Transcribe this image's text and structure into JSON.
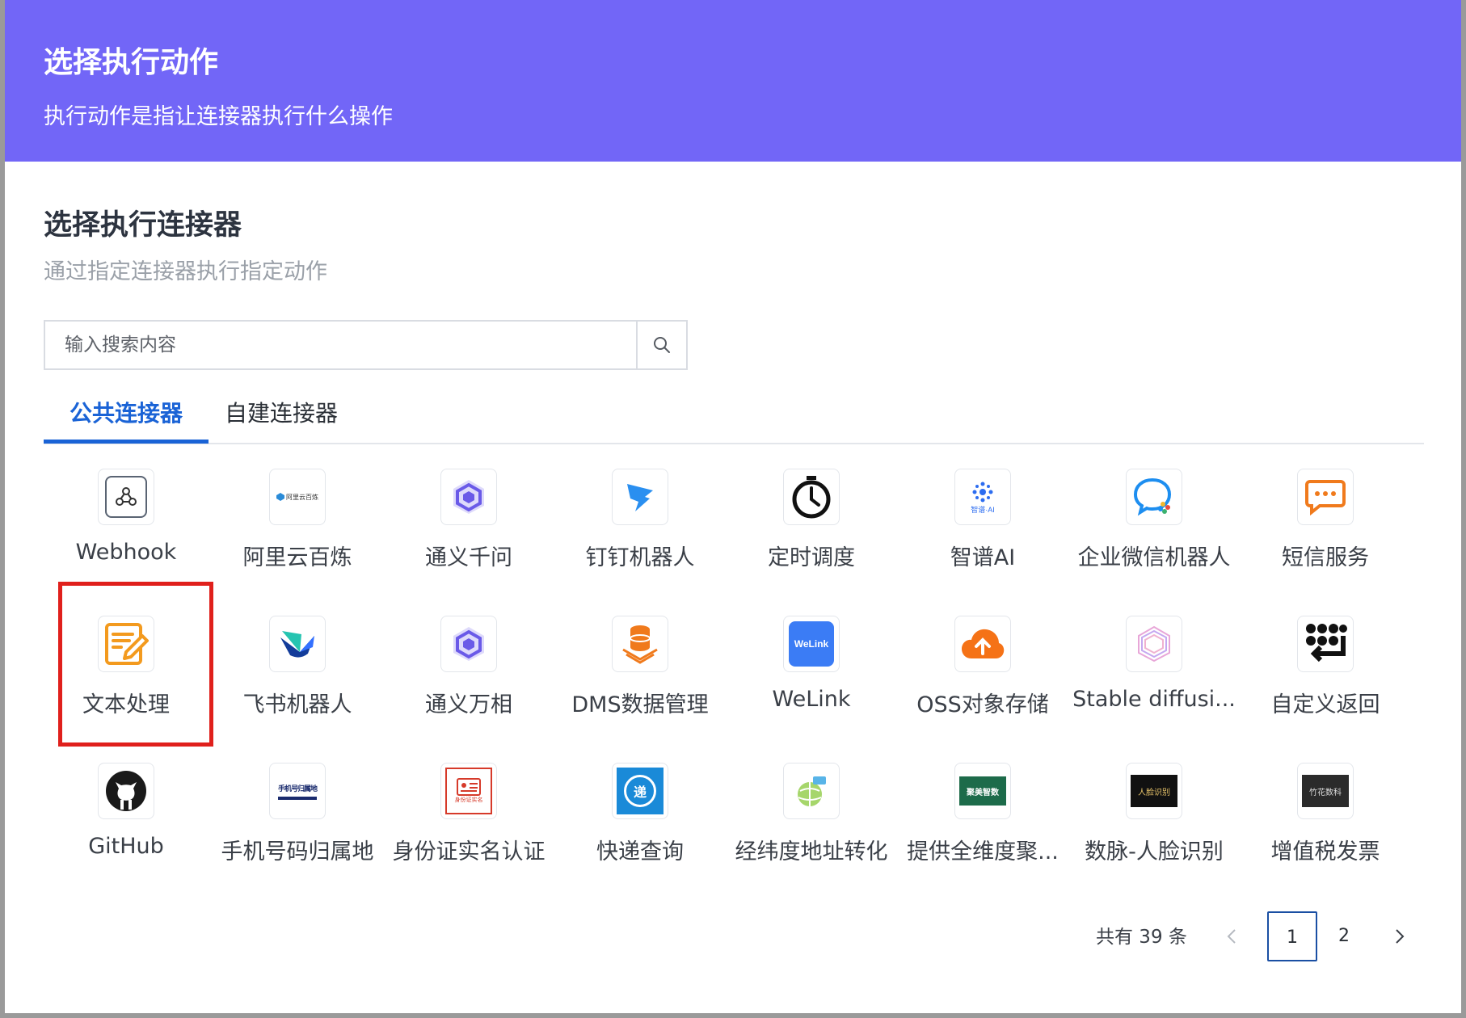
{
  "header": {
    "title": "选择执行动作",
    "subtitle": "执行动作是指让连接器执行什么操作"
  },
  "section": {
    "title": "选择执行连接器",
    "subtitle": "通过指定连接器执行指定动作"
  },
  "search": {
    "placeholder": "输入搜索内容"
  },
  "tabs": [
    {
      "label": "公共连接器",
      "active": true
    },
    {
      "label": "自建连接器",
      "active": false
    }
  ],
  "connectors": [
    {
      "label": "Webhook",
      "icon": "webhook-icon"
    },
    {
      "label": "阿里云百炼",
      "icon": "aliyun-bailian-logo",
      "logo_text": "阿里云百炼"
    },
    {
      "label": "通义千问",
      "icon": "tongyi-qianwen-logo"
    },
    {
      "label": "钉钉机器人",
      "icon": "dingtalk-icon"
    },
    {
      "label": "定时调度",
      "icon": "stopwatch-icon"
    },
    {
      "label": "智谱AI",
      "icon": "zhipu-ai-logo",
      "logo_text": "智谱·AI"
    },
    {
      "label": "企业微信机器人",
      "icon": "wecom-icon"
    },
    {
      "label": "短信服务",
      "icon": "sms-chat-icon"
    },
    {
      "label": "文本处理",
      "icon": "text-edit-icon"
    },
    {
      "label": "飞书机器人",
      "icon": "feishu-icon"
    },
    {
      "label": "通义万相",
      "icon": "tongyi-wanxiang-logo"
    },
    {
      "label": "DMS数据管理",
      "icon": "database-icon"
    },
    {
      "label": "WeLink",
      "icon": "welink-logo",
      "logo_text": "WeLink"
    },
    {
      "label": "OSS对象存储",
      "icon": "cloud-upload-icon"
    },
    {
      "label": "Stable diffusi...",
      "icon": "stable-diffusion-logo"
    },
    {
      "label": "自定义返回",
      "icon": "custom-return-icon"
    },
    {
      "label": "GitHub",
      "icon": "github-icon"
    },
    {
      "label": "手机号码归属地",
      "icon": "phone-location-logo",
      "logo_text": "手机号归属地"
    },
    {
      "label": "身份证实名认证",
      "icon": "id-card-icon",
      "logo_text": "身份证实名"
    },
    {
      "label": "快递查询",
      "icon": "express-query-icon",
      "logo_text": "递"
    },
    {
      "label": "经纬度地址转化",
      "icon": "globe-icon"
    },
    {
      "label": "提供全维度聚...",
      "icon": "juhe-logo",
      "logo_text": "聚美智数"
    },
    {
      "label": "数脉-人脸识别",
      "icon": "face-recognition-logo",
      "logo_text": "人脸识别"
    },
    {
      "label": "增值税发票",
      "icon": "invoice-logo",
      "logo_text": "竹花数科"
    }
  ],
  "highlighted_index": 8,
  "pagination": {
    "total_text": "共有 39 条",
    "pages": [
      "1",
      "2"
    ],
    "current": "1"
  },
  "colors": {
    "header_bg": "#7266f7",
    "accent": "#1a63d6",
    "highlight": "#e0201c"
  }
}
